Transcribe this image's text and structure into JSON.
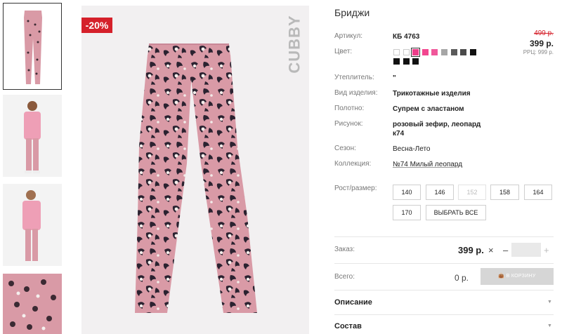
{
  "product": {
    "title": "Бриджи",
    "discount_badge": "-20%",
    "brand": "CUBBY"
  },
  "attributes": [
    {
      "label": "Артикул:",
      "value": "КБ 4763"
    },
    {
      "label": "Цвет:",
      "value": ""
    },
    {
      "label": "Утеплитель:",
      "value": "\""
    },
    {
      "label": "Вид изделия:",
      "value": "Трикотажные изделия"
    },
    {
      "label": "Полотно:",
      "value": "Супрем с эластаном"
    },
    {
      "label": "Рисунок:",
      "value": "розовый зефир, леопард к74"
    },
    {
      "label": "Сезон:",
      "value": "Весна-Лето"
    },
    {
      "label": "Коллекция:",
      "value": "№74 Милый леопард"
    }
  ],
  "pricing": {
    "old_price": "499 р.",
    "price": "399 р.",
    "rrp": "РРЦ: 999 р."
  },
  "colors": [
    {
      "hex": "#ffffff",
      "selected": false
    },
    {
      "hex": "#ffffff",
      "selected": false
    },
    {
      "hex": "#ee3d8a",
      "selected": true
    },
    {
      "hex": "#f2468f",
      "selected": false
    },
    {
      "hex": "#f0579a",
      "selected": false
    },
    {
      "hex": "#a6a6a6",
      "selected": false
    },
    {
      "hex": "#5a5a5a",
      "selected": false
    },
    {
      "hex": "#4a4a4a",
      "selected": false
    },
    {
      "hex": "#111111",
      "selected": false
    },
    {
      "hex": "#111111",
      "selected": false
    },
    {
      "hex": "#111111",
      "selected": false
    },
    {
      "hex": "#111111",
      "selected": false
    }
  ],
  "sizes": {
    "label": "Рост/размер:",
    "options": [
      {
        "label": "140",
        "disabled": false
      },
      {
        "label": "146",
        "disabled": false
      },
      {
        "label": "152",
        "disabled": true
      },
      {
        "label": "158",
        "disabled": false
      },
      {
        "label": "164",
        "disabled": false
      },
      {
        "label": "170",
        "disabled": false
      }
    ],
    "select_all": "ВЫБРАТЬ ВСЕ"
  },
  "order": {
    "label": "Заказ:",
    "price": "399 р.",
    "times": "×",
    "minus": "–",
    "plus": "+",
    "total_label": "Всего:",
    "total": "0 р.",
    "cart_button": "В КОРЗИНУ"
  },
  "sections": [
    {
      "title": "Описание",
      "arrow": "▼"
    },
    {
      "title": "Состав",
      "arrow": "▼"
    }
  ],
  "colors_theme": {
    "accent": "#d5202a",
    "pink": "#d99aa6"
  }
}
